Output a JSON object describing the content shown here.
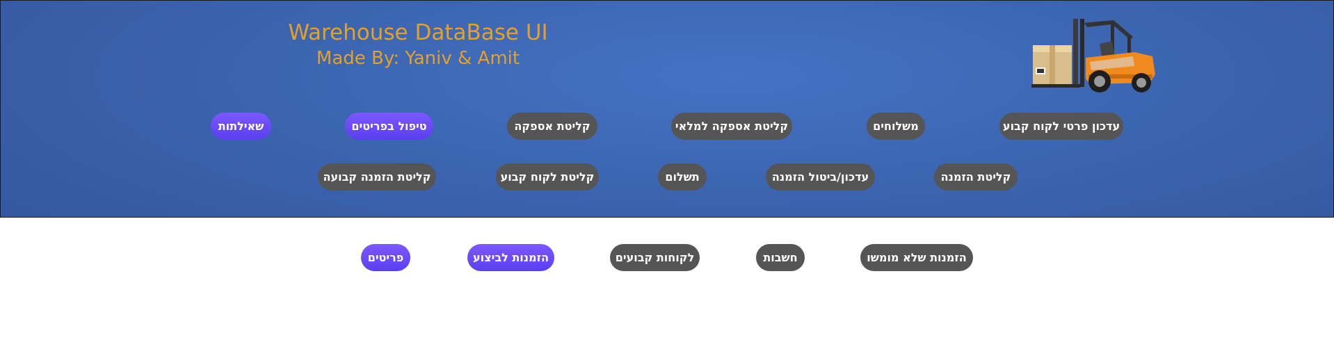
{
  "header": {
    "title": "Warehouse DataBase UI",
    "subtitle": "Made By: Yaniv & Amit",
    "image": "forklift-illustration"
  },
  "nav_row1": [
    {
      "label": "עדכון פרטי לקוח קבוע",
      "style": "grey"
    },
    {
      "label": "משלוחים",
      "style": "grey"
    },
    {
      "label": "קליטת אספקה למלאי",
      "style": "grey"
    },
    {
      "label": "קליטת אספקה",
      "style": "grey"
    },
    {
      "label": "טיפול בפריטים",
      "style": "purple"
    },
    {
      "label": "שאילתות",
      "style": "purple"
    }
  ],
  "nav_row2": [
    {
      "label": "קליטת הזמנה",
      "style": "grey"
    },
    {
      "label": "עדכון/ביטול הזמנה",
      "style": "grey"
    },
    {
      "label": "תשלום",
      "style": "grey"
    },
    {
      "label": "קליטת לקוח קבוע",
      "style": "grey"
    },
    {
      "label": "קליטת הזמנה קבועה",
      "style": "grey"
    }
  ],
  "query_row": [
    {
      "label": "הזמנות שלא מומשו",
      "style": "grey"
    },
    {
      "label": "חשבות",
      "style": "grey"
    },
    {
      "label": "לקוחות קבועים",
      "style": "grey"
    },
    {
      "label": "הזמנות לביצוע",
      "style": "purple"
    },
    {
      "label": "פריטים",
      "style": "purple"
    }
  ],
  "colors": {
    "header_bg": "#3b63ad",
    "title": "#e5a028",
    "button_grey": "#555555",
    "button_purple": "#6a4cf5"
  }
}
